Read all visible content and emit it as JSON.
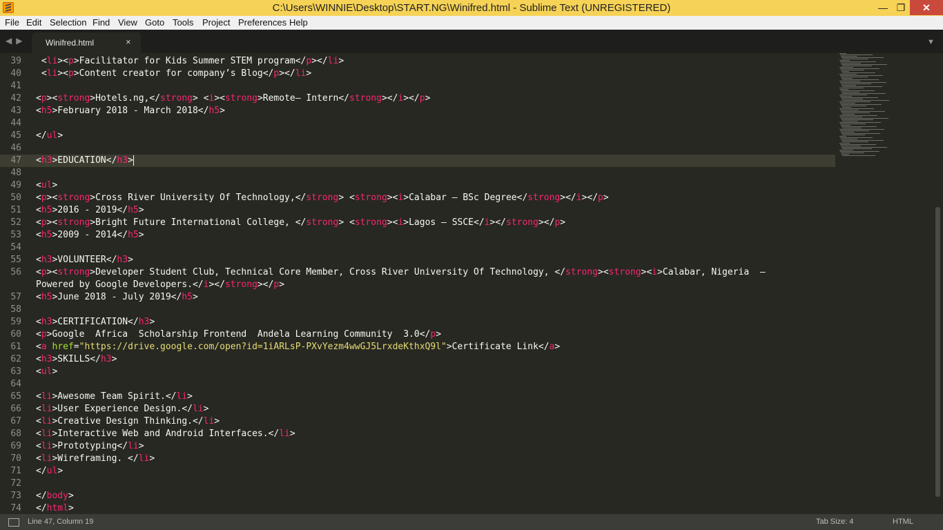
{
  "window": {
    "title": "C:\\Users\\WINNIE\\Desktop\\START.NG\\Winifred.html - Sublime Text (UNREGISTERED)",
    "minimize": "—",
    "maximize": "❐",
    "close": "✕"
  },
  "menu": [
    "File",
    "Edit",
    "Selection",
    "Find",
    "View",
    "Goto",
    "Tools",
    "Project",
    "Preferences",
    "Help"
  ],
  "tabs": [
    {
      "label": "Winifred.html",
      "close": "×"
    }
  ],
  "editor": {
    "current_line": 47,
    "lines": [
      {
        "n": "39",
        "code": " <li><p>Facilitator for Kids Summer STEM program</p></li>"
      },
      {
        "n": "40",
        "code": " <li><p>Content creator for company’s Blog</p></li>"
      },
      {
        "n": "41",
        "code": ""
      },
      {
        "n": "42",
        "code": "<p><strong>Hotels.ng,</strong> <i><strong>Remote– Intern</strong></i></p>"
      },
      {
        "n": "43",
        "code": "<h5>February 2018 - March 2018</h5>"
      },
      {
        "n": "44",
        "code": ""
      },
      {
        "n": "45",
        "code": "</ul>"
      },
      {
        "n": "46",
        "code": ""
      },
      {
        "n": "47",
        "code": "<h3>EDUCATION</h3>"
      },
      {
        "n": "48",
        "code": ""
      },
      {
        "n": "49",
        "code": "<ul>"
      },
      {
        "n": "50",
        "code": "<p><strong>Cross River University Of Technology,</strong> <strong><i>Calabar – BSc Degree</strong></i></p>"
      },
      {
        "n": "51",
        "code": "<h5>2016 - 2019</h5>"
      },
      {
        "n": "52",
        "code": "<p><strong>Bright Future International College, </strong> <strong><i>Lagos – SSCE</i></strong></p>"
      },
      {
        "n": "53",
        "code": "<h5>2009 - 2014</h5>"
      },
      {
        "n": "54",
        "code": ""
      },
      {
        "n": "55",
        "code": "<h3>VOLUNTEER</h3>"
      },
      {
        "n": "56",
        "code": "<p><strong>Developer Student Club, Technical Core Member, Cross River University Of Technology, </strong><strong><i>Calabar, Nigeria  –"
      },
      {
        "n": "",
        "code": "Powered by Google Developers.</i></strong></p>"
      },
      {
        "n": "57",
        "code": "<h5>June 2018 - July 2019</h5>"
      },
      {
        "n": "58",
        "code": ""
      },
      {
        "n": "59",
        "code": "<h3>CERTIFICATION</h3>"
      },
      {
        "n": "60",
        "code": "<p>Google  Africa  Scholarship Frontend  Andela Learning Community  3.0</p>"
      },
      {
        "n": "61",
        "code": "<a href=\"https://drive.google.com/open?id=1iARLsP-PXvYezm4wwGJ5LrxdeKthxQ9l\">Certificate Link</a>"
      },
      {
        "n": "62",
        "code": "<h3>SKILLS</h3>"
      },
      {
        "n": "63",
        "code": "<ul>"
      },
      {
        "n": "64",
        "code": ""
      },
      {
        "n": "65",
        "code": "<li>Awesome Team Spirit.</li>"
      },
      {
        "n": "66",
        "code": "<li>User Experience Design.</li>"
      },
      {
        "n": "67",
        "code": "<li>Creative Design Thinking.</li>"
      },
      {
        "n": "68",
        "code": "<li>Interactive Web and Android Interfaces.</li>"
      },
      {
        "n": "69",
        "code": "<li>Prototyping</li>"
      },
      {
        "n": "70",
        "code": "<li>Wireframing. </li>"
      },
      {
        "n": "71",
        "code": "</ul>"
      },
      {
        "n": "72",
        "code": ""
      },
      {
        "n": "73",
        "code": "</body>"
      },
      {
        "n": "74",
        "code": "</html>"
      }
    ]
  },
  "status": {
    "position": "Line 47, Column 19",
    "tab_size": "Tab Size: 4",
    "syntax": "HTML"
  },
  "colors": {
    "background": "#272822",
    "tag": "#f92672",
    "string": "#e6db74",
    "attribute": "#a6e22e",
    "text": "#f8f8f2",
    "titlebar": "#f6d256"
  }
}
